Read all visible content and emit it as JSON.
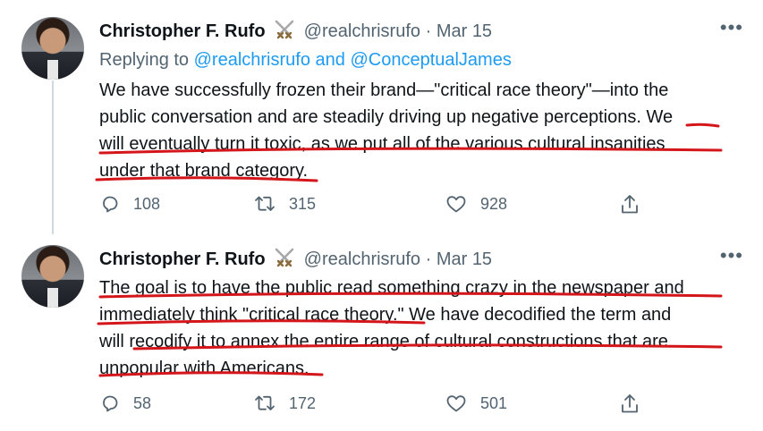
{
  "tweets": [
    {
      "name": "Christopher F. Rufo",
      "handle": "@realchrisrufo",
      "separator": "·",
      "date": "Mar 15",
      "replying_prefix": "Replying to ",
      "replying_handles": "@realchrisrufo and @ConceptualJames",
      "lines": [
        "We have successfully frozen their brand—\"critical race theory\"—into the",
        "public conversation and are steadily driving up negative perceptions. We",
        "will eventually turn it toxic, as we put all of the various cultural insanities",
        "under that brand category."
      ],
      "replies": "108",
      "retweets": "315",
      "likes": "928"
    },
    {
      "name": "Christopher F. Rufo",
      "handle": "@realchrisrufo",
      "separator": "·",
      "date": "Mar 15",
      "lines": [
        "The goal is to have the public read something crazy in the newspaper and",
        "immediately think \"critical race theory.\" We have decodified the term and",
        "will recodify it to annex the entire range of cultural constructions that are",
        "unpopular with Americans."
      ],
      "replies": "58",
      "retweets": "172",
      "likes": "501"
    }
  ],
  "icons": {
    "badge": "crossed-swords-icon",
    "more": "more-options-icon",
    "reply": "reply-icon",
    "retweet": "retweet-icon",
    "like": "heart-icon",
    "share": "share-icon"
  },
  "colors": {
    "link": "#1d9bf0",
    "muted": "#536471",
    "underline": "#d4161b"
  }
}
